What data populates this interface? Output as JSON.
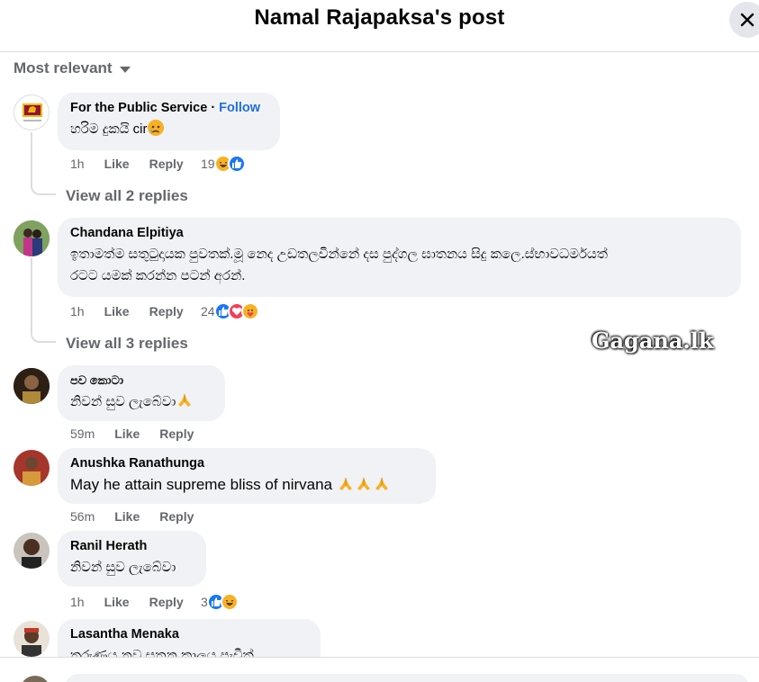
{
  "header": {
    "title": "Namal Rajapaksa's post"
  },
  "sort": {
    "label": "Most relevant"
  },
  "watermark": "Gagana.lk",
  "comments": [
    {
      "author": "For the Public Service",
      "follow": "Follow",
      "text": "හරිම දුකයි cir",
      "time": "1h",
      "like": "Like",
      "reply": "Reply",
      "reaction_count": "19",
      "reactions": [
        "haha",
        "like"
      ],
      "view_replies": "View all 2 replies"
    },
    {
      "author": "Chandana Elpitiya",
      "text_line1": "ඉතාමත්ම සතුටුදායක පුවතක්.මූ නෙද උඩතලවින්නේ දස පුද්ගල ඝාතනය සිදු කලෙ.ස්භාවධර්මයත්",
      "text_line2": "රටට යමක් කරන්න පටන් අරන්.",
      "time": "1h",
      "like": "Like",
      "reply": "Reply",
      "reaction_count": "24",
      "reactions": [
        "like",
        "love",
        "care"
      ],
      "view_replies": "View all 3 replies"
    },
    {
      "author": "පව කොටා",
      "text": "නිවන් සුව ලැබේවා",
      "time": "59m",
      "like": "Like",
      "reply": "Reply"
    },
    {
      "author": "Anushka Ranathunga",
      "text": "May he attain supreme bliss of nirvana",
      "time": "56m",
      "like": "Like",
      "reply": "Reply"
    },
    {
      "author": "Ranil Herath",
      "text": "නිවන් සුව ලැබේවා",
      "time": "1h",
      "like": "Like",
      "reply": "Reply",
      "reaction_count": "3",
      "reactions": [
        "like",
        "haha"
      ]
    },
    {
      "author": "Lasantha Menaka",
      "text": "තරුණය නව ඝතන කාලය පැවීත්"
    }
  ],
  "colors": {
    "like_blue": "#1877f2",
    "love_red": "#f33e58",
    "haha_yellow": "#f7b125",
    "link_blue": "#216fdb",
    "meta_gray": "#65676b",
    "bubble_bg": "#f0f2f5"
  }
}
